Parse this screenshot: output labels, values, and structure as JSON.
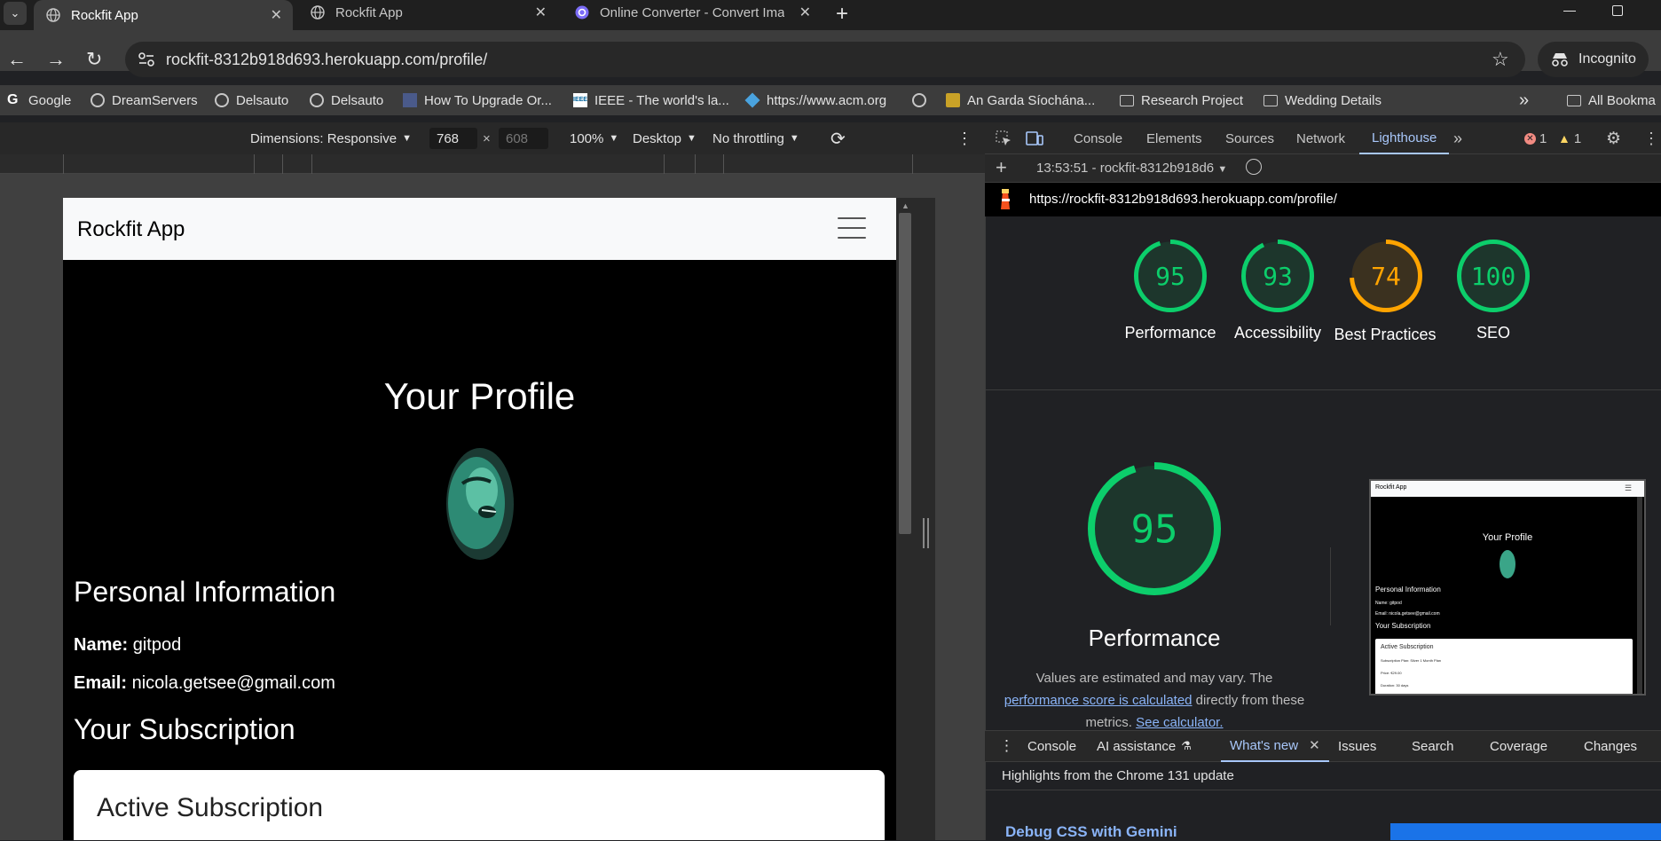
{
  "tabs": [
    {
      "title": "Rockfit App",
      "active": true
    },
    {
      "title": "Rockfit App",
      "active": false
    },
    {
      "title": "Online Converter - Convert Ima",
      "active": false
    }
  ],
  "address": {
    "url": "rockfit-8312b918d693.herokuapp.com/profile/"
  },
  "incognito_label": "Incognito",
  "bookmarks": [
    {
      "label": "Google"
    },
    {
      "label": "DreamServers"
    },
    {
      "label": "Delsauto"
    },
    {
      "label": "Delsauto"
    },
    {
      "label": "How To Upgrade Or..."
    },
    {
      "label": "IEEE - The world's la..."
    },
    {
      "label": "https://www.acm.org"
    },
    {
      "label": ""
    },
    {
      "label": "An Garda Síochána..."
    },
    {
      "label": "Research Project"
    },
    {
      "label": "Wedding Details"
    }
  ],
  "all_bookmarks": "All Bookma",
  "device_toolbar": {
    "dimensions": "Dimensions: Responsive",
    "width": "768",
    "height": "608",
    "zoom": "100%",
    "device_type": "Desktop",
    "throttling": "No throttling"
  },
  "page": {
    "brand": "Rockfit App",
    "title": "Your Profile",
    "personal_heading": "Personal Information",
    "name_label": "Name:",
    "name_value": "gitpod",
    "email_label": "Email:",
    "email_value": "nicola.getsee@gmail.com",
    "subscription_heading": "Your Subscription",
    "card_title": "Active Subscription"
  },
  "devtools": {
    "tabs": [
      "Console",
      "Elements",
      "Sources",
      "Network",
      "Lighthouse"
    ],
    "active_tab": "Lighthouse",
    "errors": "1",
    "warnings": "1",
    "report_selector": "13:53:51 - rockfit-8312b918d6",
    "report_url": "https://rockfit-8312b918d693.herokuapp.com/profile/",
    "scores": [
      {
        "label": "Performance",
        "value": "95",
        "color": "#0cce6b",
        "fraction": 0.95
      },
      {
        "label": "Accessibility",
        "value": "93",
        "color": "#0cce6b",
        "fraction": 0.93
      },
      {
        "label": "Best Practices",
        "value": "74",
        "color": "#ffa400",
        "fraction": 0.74
      },
      {
        "label": "SEO",
        "value": "100",
        "color": "#0cce6b",
        "fraction": 1.0
      }
    ],
    "big_score": {
      "value": "95",
      "label": "Performance",
      "fraction": 0.95
    },
    "note_pre": "Values are estimated and may vary. The ",
    "note_link": "performance score is calculated",
    "note_mid": " directly from these metrics. ",
    "note_link2": "See calculator.",
    "thumbnail": {
      "brand": "Rockfit App",
      "title": "Your Profile",
      "personal": "Personal Information",
      "name": "Name: gitpod",
      "email": "Email: nicola.getsee@gmail.com",
      "subscription": "Your Subscription",
      "card_title": "Active Subscription",
      "plan": "Subscription Plan: Silver 1 Month Plan",
      "price": "Price: €29.00",
      "duration": "Duration: 30 days"
    },
    "drawer_tabs": [
      "Console",
      "AI assistance",
      "What's new",
      "Issues",
      "Search",
      "Coverage",
      "Changes"
    ],
    "drawer_active": "What's new",
    "whats_new": "Highlights from the Chrome 131 update",
    "debug_title": "Debug CSS with Gemini"
  },
  "colors": {
    "pass": "#0cce6b",
    "average": "#ffa400",
    "link": "#8ab4f8",
    "active_tab": "#a8c7fa"
  }
}
